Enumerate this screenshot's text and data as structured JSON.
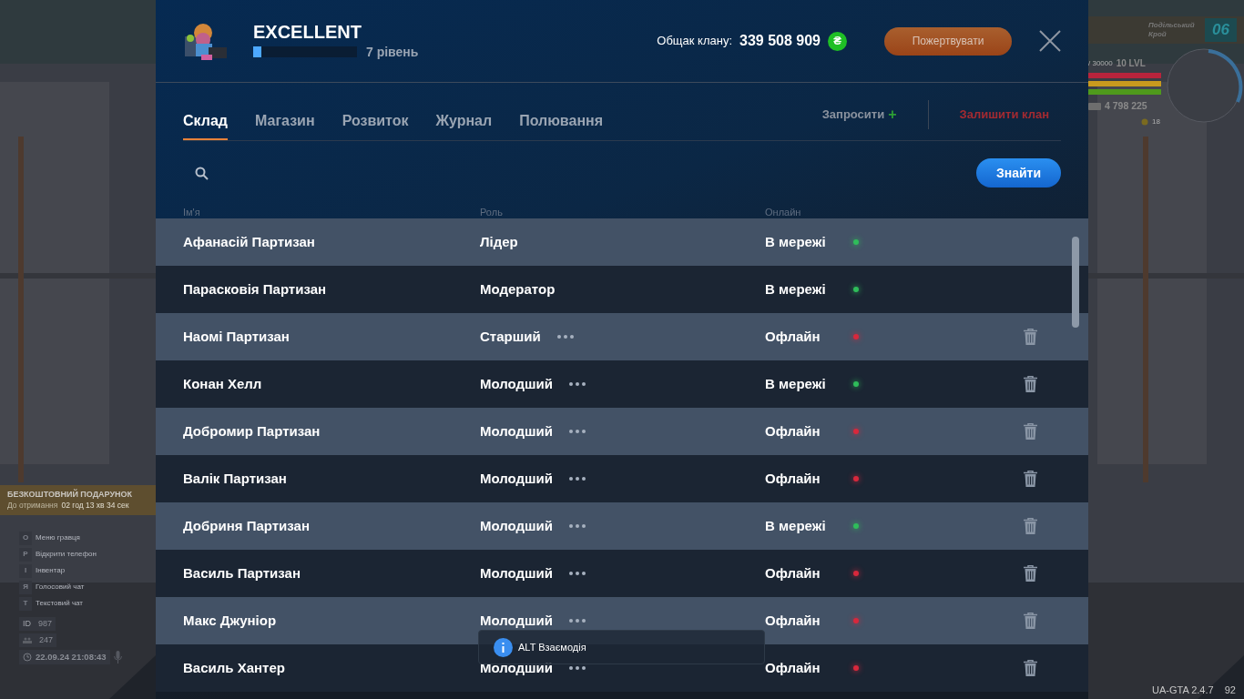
{
  "game_hud": {
    "gift": {
      "title": "БЕЗКОШТОВНИЙ ПОДАРУНОК",
      "timer_label": "До отримання",
      "timer": "02 год 13 хв 34 сек"
    },
    "hotkeys": [
      {
        "key": "O",
        "label": "Меню гравця"
      },
      {
        "key": "P",
        "label": "Відкрити телефон"
      },
      {
        "key": "I",
        "label": "Інвентар"
      },
      {
        "key": "Я",
        "label": "Голосовий чат"
      },
      {
        "key": "T",
        "label": "Текстовий чат"
      }
    ],
    "id_label": "ID",
    "id": "987",
    "players": "247",
    "datetime": "22.09.24 21:08:43",
    "zone": "Подільський Крой",
    "zone_number": "06",
    "xp": "/ 30000",
    "player_level": "10 LVL",
    "bars": [
      {
        "color": "#b8243c",
        "level": 1
      },
      {
        "color": "#c99a1e",
        "level": 1
      },
      {
        "color": "#4f9a1c",
        "level": 1
      }
    ],
    "money": "4 798 225",
    "coins": "18",
    "version": "UA-GTA 2.4.7",
    "fps": "92"
  },
  "clan": {
    "name": "EXCELLENT",
    "progress": {
      "level": 0.08
    },
    "level_text": "7 рівень",
    "treasury_label": "Общак клану:",
    "treasury": "339 508 909",
    "currency": "₴",
    "donate_button": "Пожертвувати"
  },
  "tabs": [
    {
      "label": "Склад",
      "selected": true
    },
    {
      "label": "Магазин",
      "selected": false
    },
    {
      "label": "Розвиток",
      "selected": false
    },
    {
      "label": "Журнал",
      "selected": false
    },
    {
      "label": "Полювання",
      "selected": false
    }
  ],
  "invite": "Запросити",
  "invite_plus": "+",
  "leave": "Залишити клан",
  "search_button": "Знайти",
  "table": {
    "columns": [
      "Ім'я",
      "Роль",
      "Онлайн"
    ],
    "rows": [
      {
        "name": "Афанасій Партизан",
        "role": "Лідер",
        "menu": false,
        "status": "В мережі",
        "online": true,
        "removable": false
      },
      {
        "name": "Парасковія Партизан",
        "role": "Модератор",
        "menu": false,
        "status": "В мережі",
        "online": true,
        "removable": false
      },
      {
        "name": "Наомі Партизан",
        "role": "Старший",
        "menu": true,
        "status": "Офлайн",
        "online": false,
        "removable": true
      },
      {
        "name": "Конан Хелл",
        "role": "Молодший",
        "menu": true,
        "status": "В мережі",
        "online": true,
        "removable": true
      },
      {
        "name": "Добромир Партизан",
        "role": "Молодший",
        "menu": true,
        "status": "Офлайн",
        "online": false,
        "removable": true
      },
      {
        "name": "Валік Партизан",
        "role": "Молодший",
        "menu": true,
        "status": "Офлайн",
        "online": false,
        "removable": true
      },
      {
        "name": "Добриня Партизан",
        "role": "Молодший",
        "menu": true,
        "status": "В мережі",
        "online": true,
        "removable": true
      },
      {
        "name": "Василь Партизан",
        "role": "Молодший",
        "menu": true,
        "status": "Офлайн",
        "online": false,
        "removable": true
      },
      {
        "name": "Макс Джуніор",
        "role": "Молодший",
        "menu": true,
        "status": "Офлайн",
        "online": false,
        "removable": true
      },
      {
        "name": "Василь Хантер",
        "role": "Молодший",
        "menu": true,
        "status": "Офлайн",
        "online": false,
        "removable": true
      }
    ]
  },
  "tooltip": "ALT Взаємодія"
}
